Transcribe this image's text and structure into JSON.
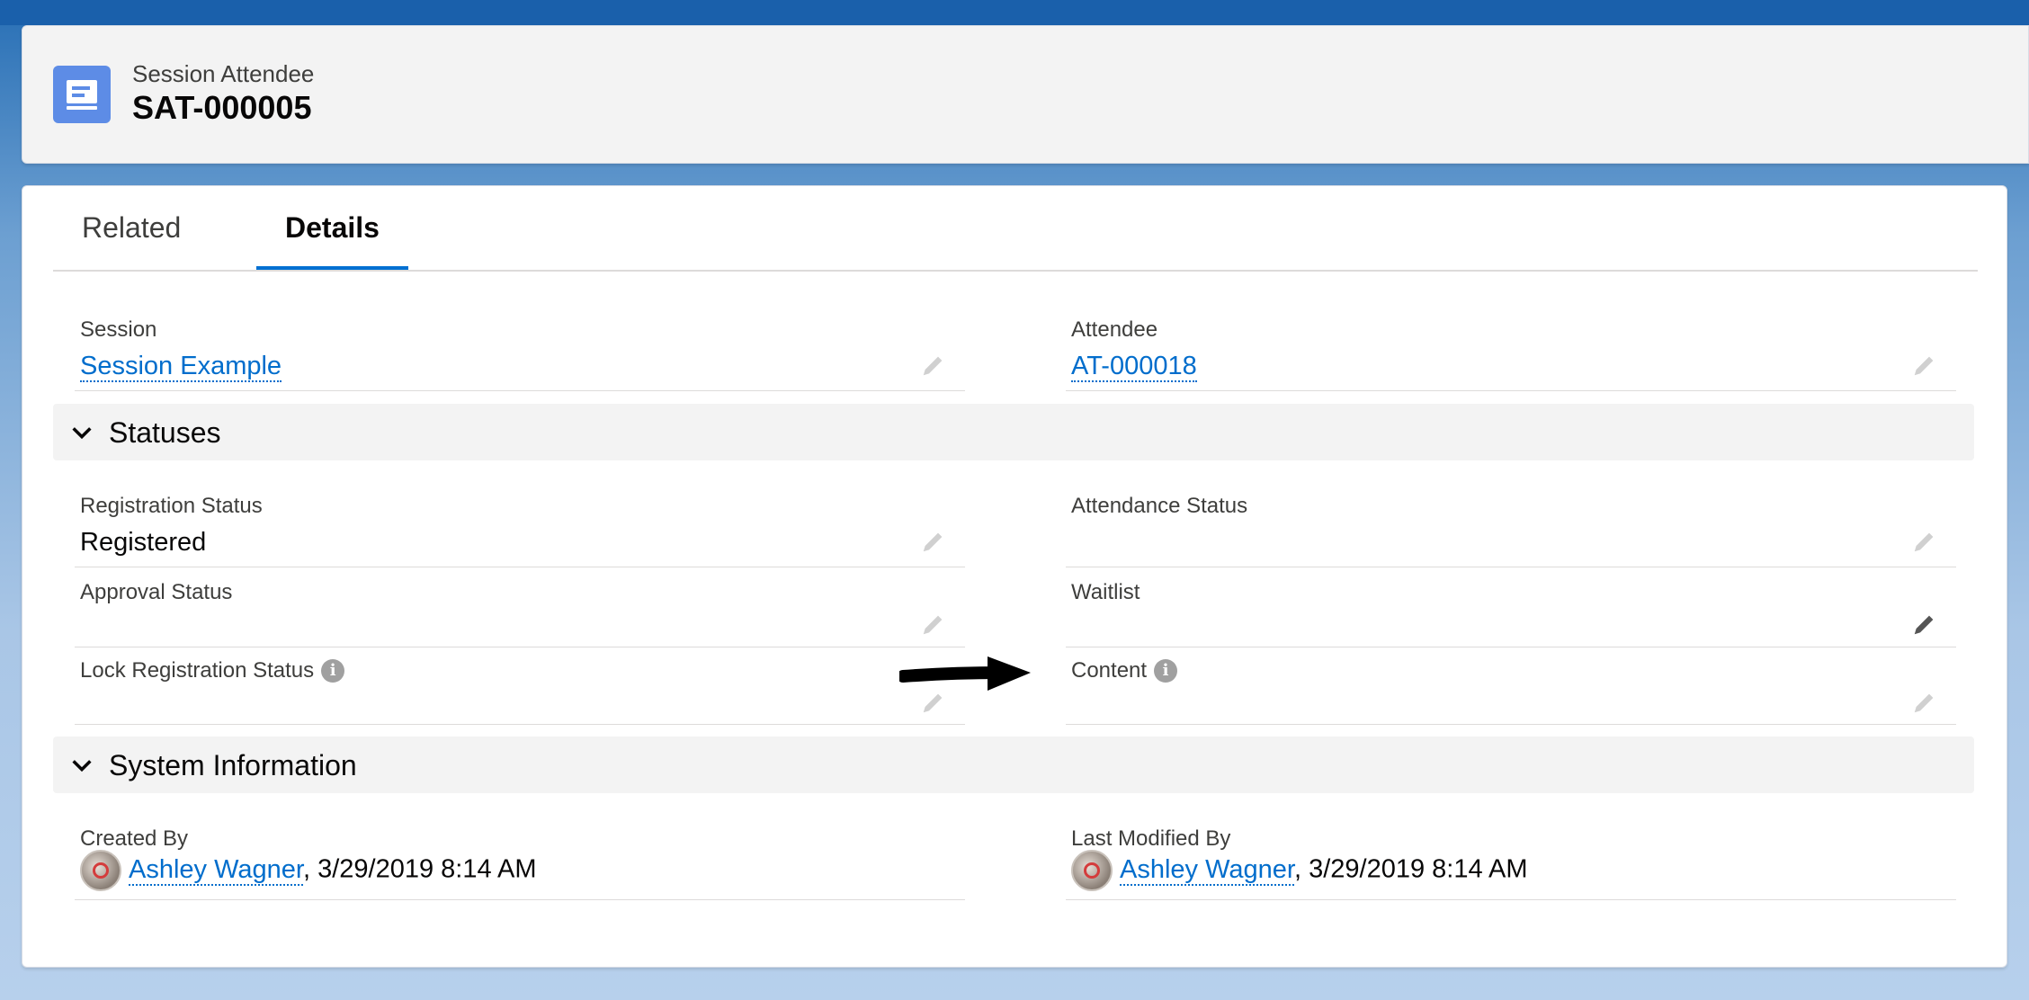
{
  "header": {
    "object_type": "Session Attendee",
    "record_name": "SAT-000005",
    "icon": "record-icon",
    "icon_color": "#5d8ce6"
  },
  "tabs": [
    {
      "label": "Related",
      "active": false
    },
    {
      "label": "Details",
      "active": true
    }
  ],
  "fields": {
    "session": {
      "label": "Session",
      "value": "Session Example"
    },
    "attendee": {
      "label": "Attendee",
      "value": "AT-000018"
    }
  },
  "sections": {
    "statuses": {
      "title": "Statuses",
      "registration_status": {
        "label": "Registration Status",
        "value": "Registered"
      },
      "attendance_status": {
        "label": "Attendance Status",
        "value": ""
      },
      "approval_status": {
        "label": "Approval Status",
        "value": ""
      },
      "waitlist": {
        "label": "Waitlist",
        "value": ""
      },
      "lock_registration_status": {
        "label": "Lock Registration Status",
        "value": ""
      },
      "content": {
        "label": "Content",
        "value": ""
      }
    },
    "system_information": {
      "title": "System Information",
      "created_by": {
        "label": "Created By",
        "user": "Ashley Wagner",
        "date": ", 3/29/2019 8:14 AM"
      },
      "last_modified_by": {
        "label": "Last Modified By",
        "user": "Ashley Wagner",
        "date": ", 3/29/2019 8:14 AM"
      }
    }
  },
  "colors": {
    "link": "#006dcc",
    "active_tab_underline": "#0070d2"
  }
}
